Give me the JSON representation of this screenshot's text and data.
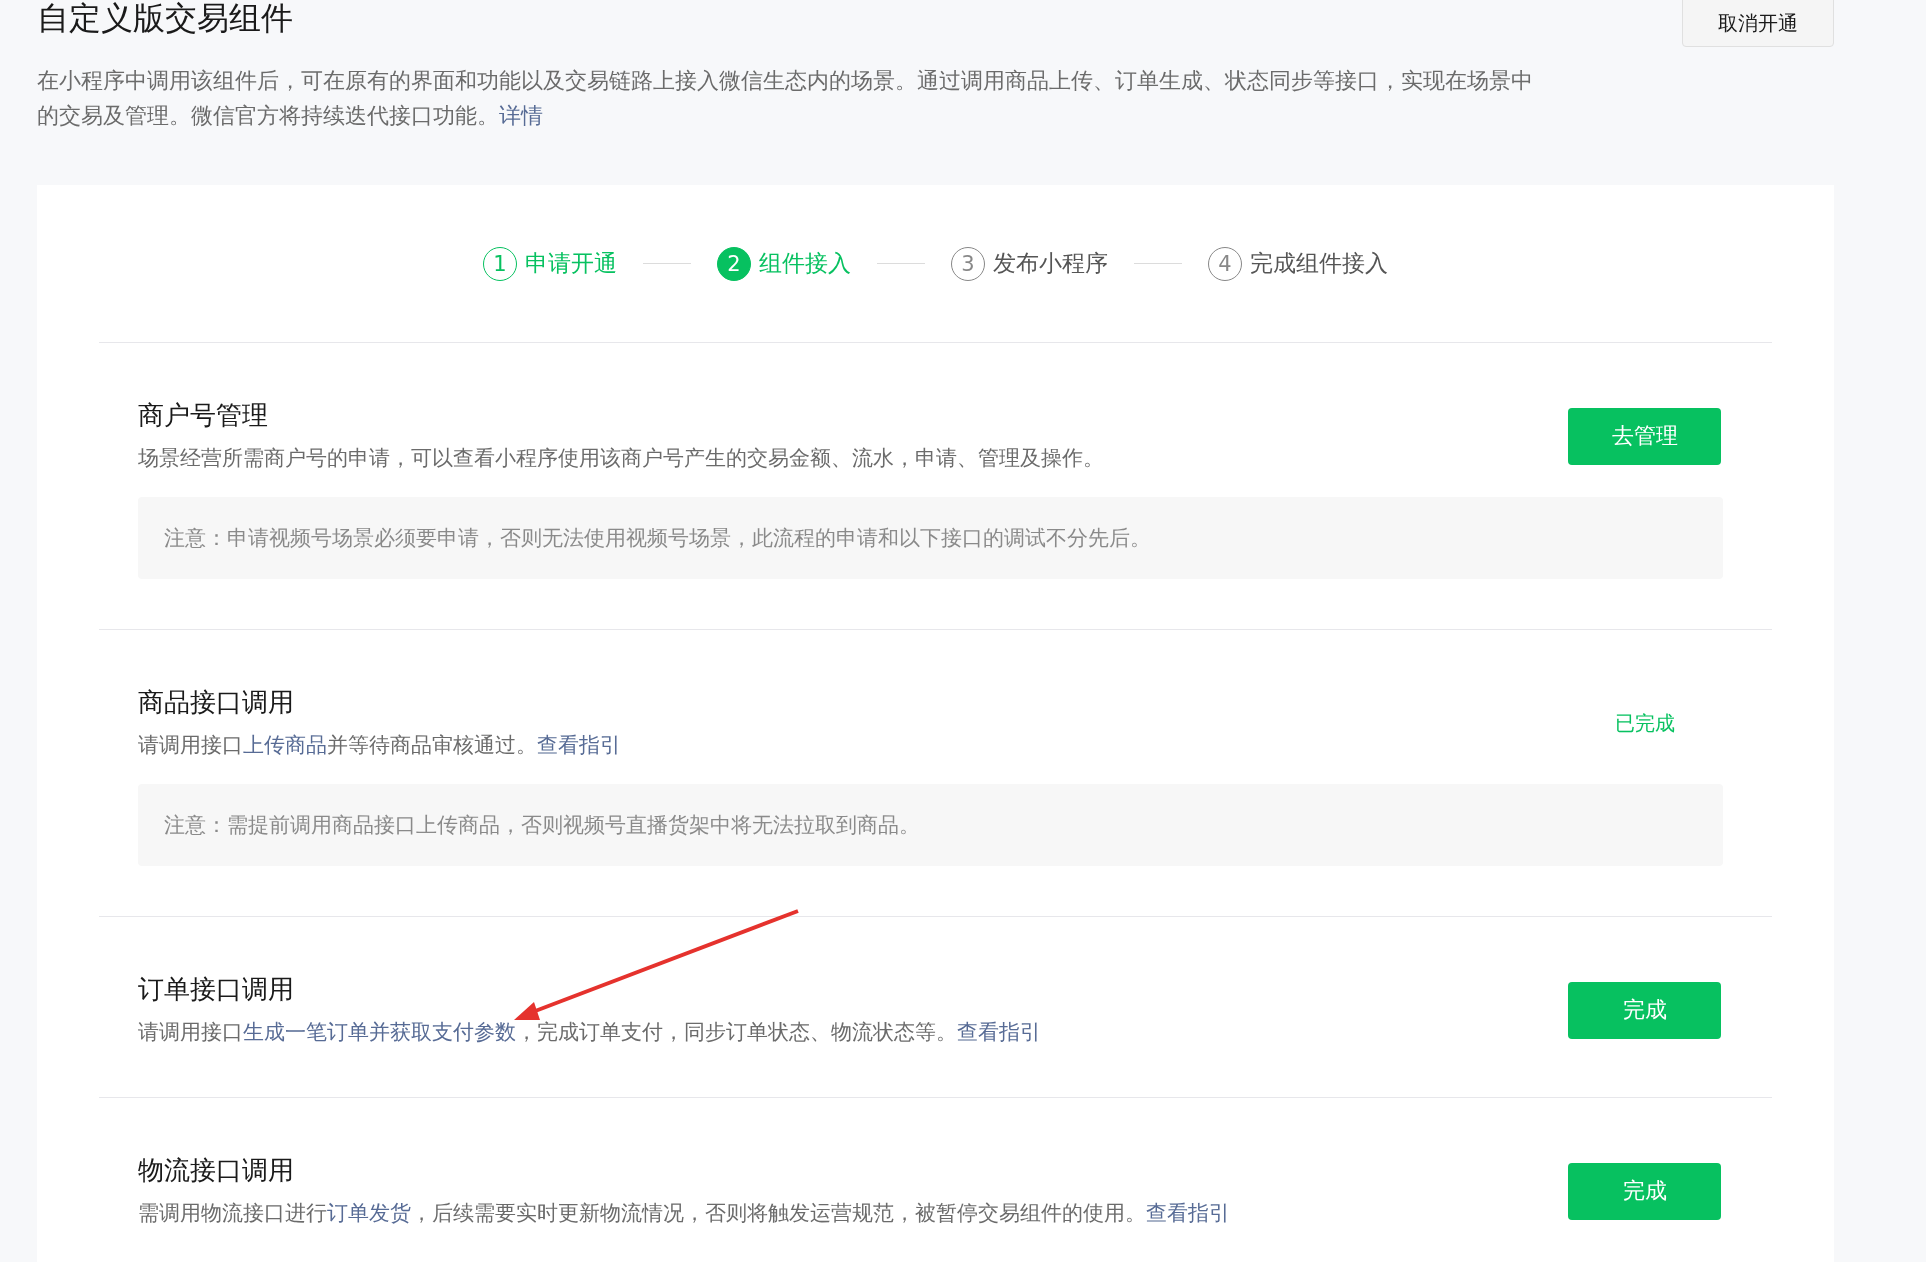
{
  "page": {
    "title": "自定义版交易组件",
    "cancel_button": "取消开通",
    "description": [
      {
        "kind": "plain",
        "text": "在小程序中调用该组件后，可在原有的界面和功能以及交易链路上接入微信生态内的场景。通过调用商品上传、订单生成、状态同步等接口，实现在场景中的交易及管理。微信官方将持续迭代接口功能。"
      },
      {
        "kind": "link",
        "text": "详情"
      }
    ]
  },
  "steps": [
    {
      "number": "1",
      "label": "申请开通",
      "completed": true,
      "selected": false
    },
    {
      "number": "2",
      "label": "组件接入",
      "completed": false,
      "selected": true
    },
    {
      "number": "3",
      "label": "发布小程序",
      "completed": false,
      "selected": false
    },
    {
      "number": "4",
      "label": "完成组件接入",
      "completed": false,
      "selected": false
    }
  ],
  "sections": [
    {
      "title": "商户号管理",
      "description": [
        {
          "kind": "plain",
          "text": "场景经营所需商户号的申请，可以查看小程序使用该商户号产生的交易金额、流水，申请、管理及操作。"
        }
      ],
      "note": "注意：申请视频号场景必须要申请，否则无法使用视频号场景，此流程的申请和以下接口的调试不分先后。",
      "action": {
        "kind": "button",
        "text": "去管理"
      }
    },
    {
      "title": "商品接口调用",
      "description": [
        {
          "kind": "plain",
          "text": "请调用接口"
        },
        {
          "kind": "term",
          "text": "上传商品"
        },
        {
          "kind": "plain",
          "text": "并等待商品审核通过。"
        },
        {
          "kind": "link",
          "text": "查看指引"
        }
      ],
      "note": "注意：需提前调用商品接口上传商品，否则视频号直播货架中将无法拉取到商品。",
      "action": {
        "kind": "status",
        "text": "已完成"
      }
    },
    {
      "title": "订单接口调用",
      "description": [
        {
          "kind": "plain",
          "text": "请调用接口"
        },
        {
          "kind": "term",
          "text": "生成一笔订单并获取支付参数"
        },
        {
          "kind": "plain",
          "text": "，完成订单支付，同步订单状态、物流状态等。"
        },
        {
          "kind": "link",
          "text": "查看指引"
        }
      ],
      "action": {
        "kind": "button",
        "text": "完成"
      }
    },
    {
      "title": "物流接口调用",
      "description": [
        {
          "kind": "plain",
          "text": "需调用物流接口进行"
        },
        {
          "kind": "term",
          "text": "订单发货"
        },
        {
          "kind": "plain",
          "text": "，后续需要实时更新物流情况，否则将触发运营规范，被暂停交易组件的使用。"
        },
        {
          "kind": "link",
          "text": "查看指引"
        }
      ],
      "action": {
        "kind": "button",
        "text": "完成"
      }
    }
  ]
}
